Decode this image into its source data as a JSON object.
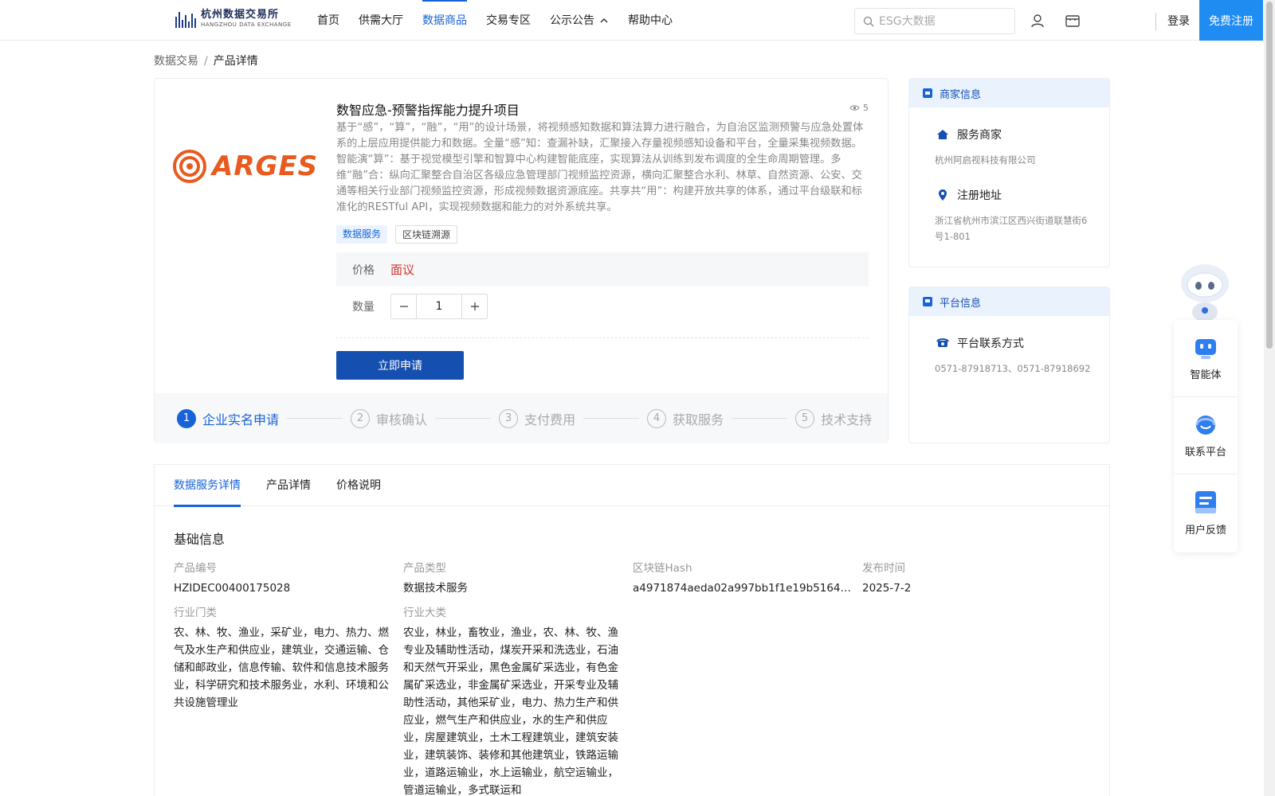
{
  "header": {
    "logo_cn": "杭州数据交易所",
    "logo_en": "HANGZHOU DATA EXCHANGE",
    "nav": [
      {
        "label": "首页"
      },
      {
        "label": "供需大厅"
      },
      {
        "label": "数据商品"
      },
      {
        "label": "交易专区"
      },
      {
        "label": "公示公告"
      },
      {
        "label": "帮助中心"
      }
    ],
    "active_nav": "数据商品",
    "search_placeholder": "ESG大数据",
    "login": "登录",
    "register": "免费注册"
  },
  "breadcrumb": {
    "parent": "数据交易",
    "separator": "/",
    "current": "产品详情"
  },
  "product": {
    "logo_text": "ARGES",
    "title": "数智应急-预警指挥能力提升项目",
    "views": "5",
    "description": "基于“感”，“算”，“融”，“用”的设计场景，将视频感知数据和算法算力进行融合，为自治区监测预警与应急处置体系的上层应用提供能力和数据。全量“感”知：查漏补缺，汇聚接入存量视频感知设备和平台，全量采集视频数据。智能演“算”：基于视觉模型引擎和智算中心构建智能底座，实现算法从训练到发布调度的全生命周期管理。多维“融”合：纵向汇聚整合自治区各级应急管理部门视频监控资源，横向汇聚整合水利、林草、自然资源、公安、交通等相关行业部门视频监控资源，形成视频数据资源底座。共享共“用”：构建开放共享的体系，通过平台级联和标准化的RESTful API，实现视频数据和能力的对外系统共享。",
    "tags": [
      "数据服务",
      "区块链溯源"
    ],
    "price_label": "价格",
    "price_value": "面议",
    "qty_label": "数量",
    "qty_value": "1",
    "apply_label": "立即申请",
    "steps": [
      {
        "num": "1",
        "label": "企业实名申请"
      },
      {
        "num": "2",
        "label": "审核确认"
      },
      {
        "num": "3",
        "label": "支付费用"
      },
      {
        "num": "4",
        "label": "获取服务"
      },
      {
        "num": "5",
        "label": "技术支持"
      }
    ]
  },
  "merchant": {
    "header": "商家信息",
    "service_title": "服务商家",
    "service_value": "杭州阿启视科技有限公司",
    "address_title": "注册地址",
    "address_value": "浙江省杭州市滨江区西兴街道联慧街6号1-801"
  },
  "platform": {
    "header": "平台信息",
    "contact_title": "平台联系方式",
    "contact_value": "0571-87918713、0571-87918692"
  },
  "side_tools": [
    {
      "label": "智能体"
    },
    {
      "label": "联系平台"
    },
    {
      "label": "用户反馈"
    }
  ],
  "detail": {
    "tabs": [
      "数据服务详情",
      "产品详情",
      "价格说明"
    ],
    "section_title": "基础信息",
    "fields": {
      "product_no_label": "产品编号",
      "product_no": "HZIDEC00400175028",
      "product_type_label": "产品类型",
      "product_type": "数据技术服务",
      "hash_label": "区块链Hash",
      "hash": "a4971874aeda02a997bb1f1e19b5164616...",
      "publish_label": "发布时间",
      "publish": "2025-7-2",
      "industry_cat_label": "行业门类",
      "industry_cat": "农、林、牧、渔业，采矿业，电力、热力、燃气及水生产和供应业，建筑业，交通运输、仓储和邮政业，信息传输、软件和信息技术服务业，科学研究和技术服务业，水利、环境和公共设施管理业",
      "industry_major_label": "行业大类",
      "industry_major": "农业，林业，畜牧业，渔业，农、林、牧、渔专业及辅助性活动，煤炭开采和洗选业，石油和天然气开采业，黑色金属矿采选业，有色金属矿采选业，非金属矿采选业，开采专业及辅助性活动，其他采矿业，电力、热力生产和供应业，燃气生产和供应业，水的生产和供应业，房屋建筑业，土木工程建筑业，建筑安装业，建筑装饰、装修和其他建筑业，铁路运输业，道路运输业，水上运输业，航空运输业，管道运输业，多式联运和"
    }
  },
  "colors": {
    "accent": "#1763d8",
    "primary_button": "#1550b0",
    "register": "#1f8cf2",
    "price": "#d6322c",
    "brand_logo": "#e85a1e"
  }
}
